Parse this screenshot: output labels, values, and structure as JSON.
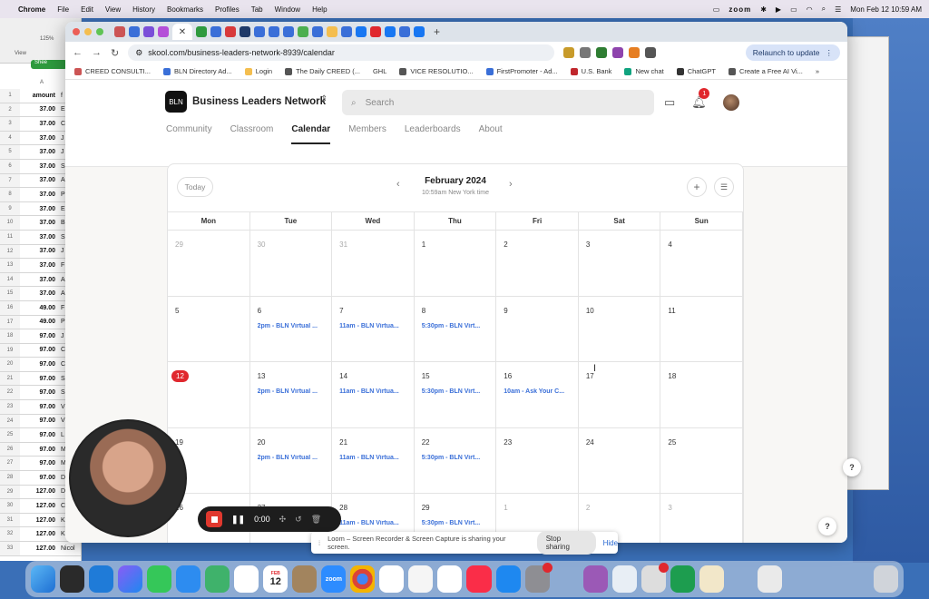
{
  "menubar": {
    "app": "Chrome",
    "items": [
      "File",
      "Edit",
      "View",
      "History",
      "Bookmarks",
      "Profiles",
      "Tab",
      "Window",
      "Help"
    ],
    "zoom_label": "zoom",
    "datetime": "Mon Feb 12  10:59 AM"
  },
  "spreadsheet": {
    "zoom": "125%",
    "view_label": "View",
    "green_label": "Shee",
    "col_a": "A",
    "header_value": "amount",
    "header_next": "f",
    "rows": [
      {
        "n": "1",
        "v": "amount",
        "e": "f"
      },
      {
        "n": "2",
        "v": "37.00",
        "e": "E"
      },
      {
        "n": "3",
        "v": "37.00",
        "e": "C"
      },
      {
        "n": "4",
        "v": "37.00",
        "e": "J"
      },
      {
        "n": "5",
        "v": "37.00",
        "e": "J"
      },
      {
        "n": "6",
        "v": "37.00",
        "e": "S"
      },
      {
        "n": "7",
        "v": "37.00",
        "e": "A"
      },
      {
        "n": "8",
        "v": "37.00",
        "e": "P"
      },
      {
        "n": "9",
        "v": "37.00",
        "e": "E"
      },
      {
        "n": "10",
        "v": "37.00",
        "e": "B"
      },
      {
        "n": "11",
        "v": "37.00",
        "e": "S"
      },
      {
        "n": "12",
        "v": "37.00",
        "e": "J"
      },
      {
        "n": "13",
        "v": "37.00",
        "e": "F"
      },
      {
        "n": "14",
        "v": "37.00",
        "e": "A"
      },
      {
        "n": "15",
        "v": "37.00",
        "e": "A"
      },
      {
        "n": "16",
        "v": "49.00",
        "e": "F"
      },
      {
        "n": "17",
        "v": "49.00",
        "e": "P"
      },
      {
        "n": "18",
        "v": "97.00",
        "e": "J"
      },
      {
        "n": "19",
        "v": "97.00",
        "e": "C"
      },
      {
        "n": "20",
        "v": "97.00",
        "e": "C"
      },
      {
        "n": "21",
        "v": "97.00",
        "e": "S"
      },
      {
        "n": "22",
        "v": "97.00",
        "e": "S"
      },
      {
        "n": "23",
        "v": "97.00",
        "e": "V"
      },
      {
        "n": "24",
        "v": "97.00",
        "e": "V"
      },
      {
        "n": "25",
        "v": "97.00",
        "e": "L"
      },
      {
        "n": "26",
        "v": "97.00",
        "e": "M"
      },
      {
        "n": "27",
        "v": "97.00",
        "e": "M"
      },
      {
        "n": "28",
        "v": "97.00",
        "e": "D"
      },
      {
        "n": "29",
        "v": "127.00",
        "e": "D"
      },
      {
        "n": "30",
        "v": "127.00",
        "e": "C"
      },
      {
        "n": "31",
        "v": "127.00",
        "e": "K"
      },
      {
        "n": "32",
        "v": "127.00",
        "e": "K"
      },
      {
        "n": "33",
        "v": "127.00",
        "e": "Nicol"
      }
    ]
  },
  "browser": {
    "url": "skool.com/business-leaders-network-8939/calendar",
    "relaunch": "Relaunch to update",
    "bookmarks": [
      "CREED CONSULTI...",
      "BLN Directory Ad...",
      "Login",
      "The Daily CREED (...",
      "GHL",
      "VICE RESOLUTIO...",
      "FirstPromoter - Ad...",
      "U.S. Bank",
      "New chat",
      "ChatGPT",
      "Create a Free AI Vi..."
    ]
  },
  "skool": {
    "community_name": "Business Leaders Network",
    "logo_text": "BLN",
    "search_placeholder": "Search",
    "notification_count": "1",
    "tabs": [
      "Community",
      "Classroom",
      "Calendar",
      "Members",
      "Leaderboards",
      "About"
    ],
    "active_tab": "Calendar"
  },
  "calendar": {
    "today_button": "Today",
    "month": "February 2024",
    "timezone_note": "10:59am New York time",
    "weekdays": [
      "Mon",
      "Tue",
      "Wed",
      "Thu",
      "Fri",
      "Sat",
      "Sun"
    ],
    "weeks": [
      [
        {
          "d": "29",
          "m": true
        },
        {
          "d": "30",
          "m": true
        },
        {
          "d": "31",
          "m": true
        },
        {
          "d": "1"
        },
        {
          "d": "2"
        },
        {
          "d": "3"
        },
        {
          "d": "4"
        }
      ],
      [
        {
          "d": "5"
        },
        {
          "d": "6",
          "ev": "2pm - BLN Virtual ..."
        },
        {
          "d": "7",
          "ev": "11am - BLN Virtua..."
        },
        {
          "d": "8",
          "ev": "5:30pm - BLN Virt..."
        },
        {
          "d": "9"
        },
        {
          "d": "10"
        },
        {
          "d": "11"
        }
      ],
      [
        {
          "d": "12",
          "today": true
        },
        {
          "d": "13",
          "ev": "2pm - BLN Virtual ..."
        },
        {
          "d": "14",
          "ev": "11am - BLN Virtua..."
        },
        {
          "d": "15",
          "ev": "5:30pm - BLN Virt..."
        },
        {
          "d": "16",
          "ev": "10am - Ask Your C..."
        },
        {
          "d": "17"
        },
        {
          "d": "18"
        }
      ],
      [
        {
          "d": "19"
        },
        {
          "d": "20",
          "ev": "2pm - BLN Virtual ..."
        },
        {
          "d": "21",
          "ev": "11am - BLN Virtua..."
        },
        {
          "d": "22",
          "ev": "5:30pm - BLN Virt..."
        },
        {
          "d": "23"
        },
        {
          "d": "24"
        },
        {
          "d": "25"
        }
      ],
      [
        {
          "d": "26"
        },
        {
          "d": "27"
        },
        {
          "d": "28",
          "ev": "11am - BLN Virtua..."
        },
        {
          "d": "29",
          "ev": "5:30pm - BLN Virt..."
        },
        {
          "d": "1",
          "m": true
        },
        {
          "d": "2",
          "m": true
        },
        {
          "d": "3",
          "m": true
        }
      ]
    ]
  },
  "recorder": {
    "time": "0:00"
  },
  "share_banner": {
    "message": "Loom – Screen Recorder & Screen Capture is sharing your screen.",
    "stop": "Stop sharing",
    "hide": "Hide"
  },
  "help_label": "?",
  "dock": {
    "calendar_month": "FEB",
    "calendar_day": "12",
    "zoom_label": "zoom"
  }
}
